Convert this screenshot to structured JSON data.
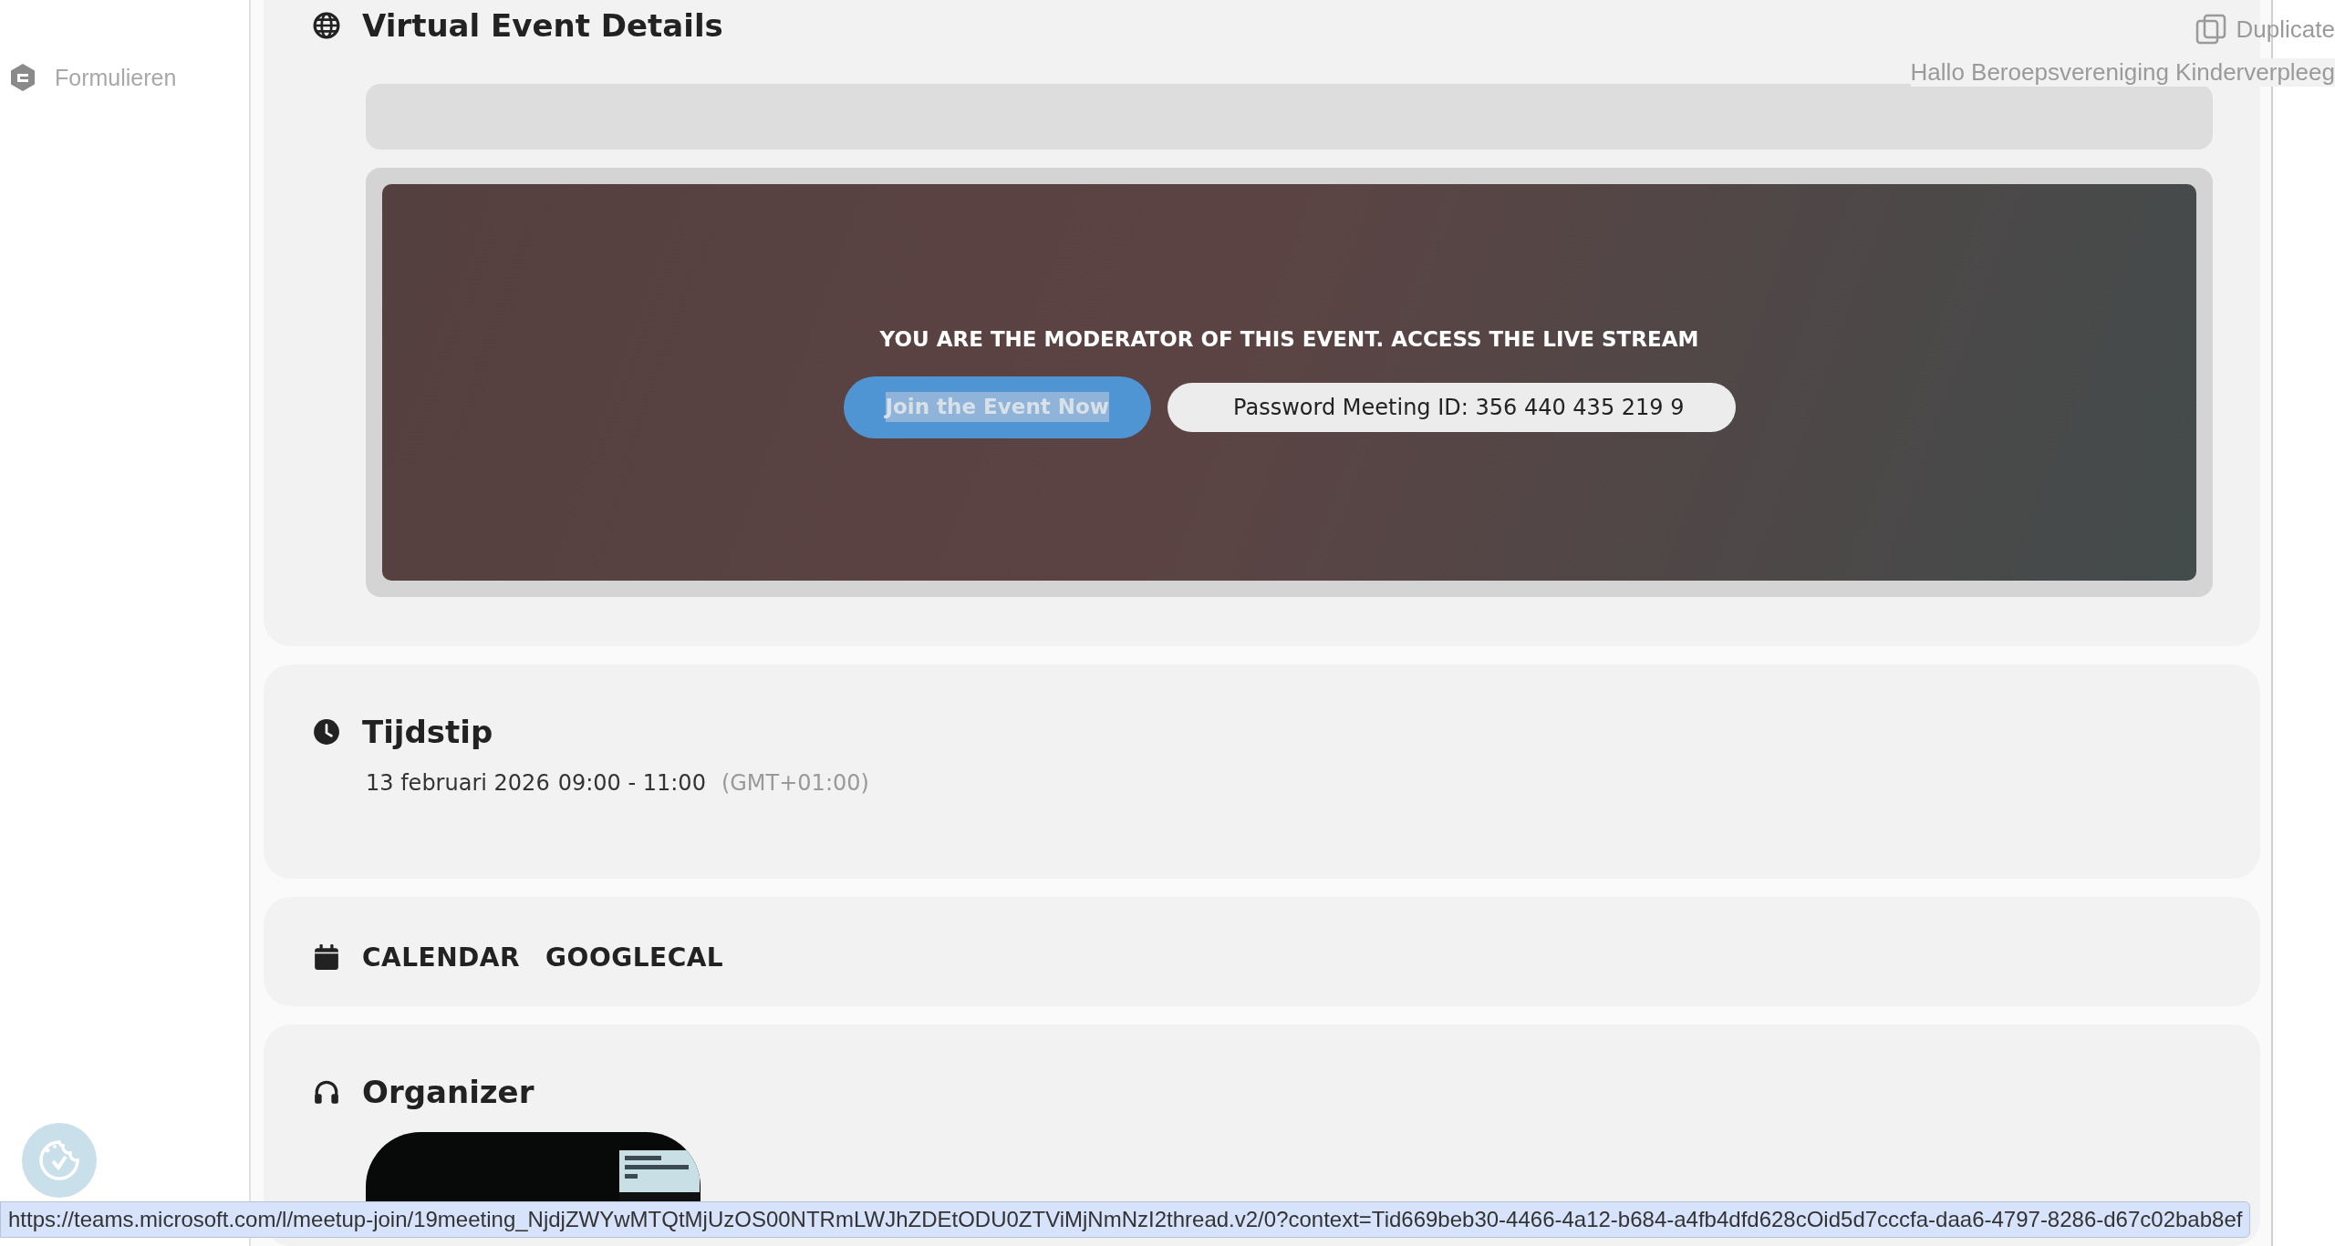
{
  "sidebar": {
    "items": [
      {
        "label": "Formulieren"
      }
    ]
  },
  "overlay": {
    "duplicate": "Duplicate",
    "greeting": "Hallo Beroepsvereniging Kinderverpleeg"
  },
  "sections": [
    {
      "kind": "virtual",
      "title": "Virtual Event Details",
      "message": "YOU ARE THE MODERATOR OF THIS EVENT. ACCESS THE LIVE STREAM",
      "join_button": {
        "label": "Join the Event Now",
        "text_selected": true
      },
      "password": "Password Meeting ID: 356 440 435 219 9"
    },
    {
      "kind": "time",
      "title": "Tijdstip",
      "date": "13 februari 2026",
      "time": "09:00 - 11:00",
      "timezone": "(GMT+01:00)"
    },
    {
      "kind": "calendar",
      "links": [
        "CALENDAR",
        "GOOGLECAL"
      ]
    },
    {
      "kind": "organizer",
      "title": "Organizer"
    }
  ],
  "status_bar": {
    "url": "https://teams.microsoft.com/l/meetup-join/19meeting_NjdjZWYwMTQtMjUzOS00NTRmLWJhZDEtODU0ZTViMjNmNzI2thread.v2/0?context=Tid669beb30-4466-4a12-b684-a4fb4dfd628cOid5d7cccfa-daa6-4797-8286-d67c02bab8ef"
  }
}
